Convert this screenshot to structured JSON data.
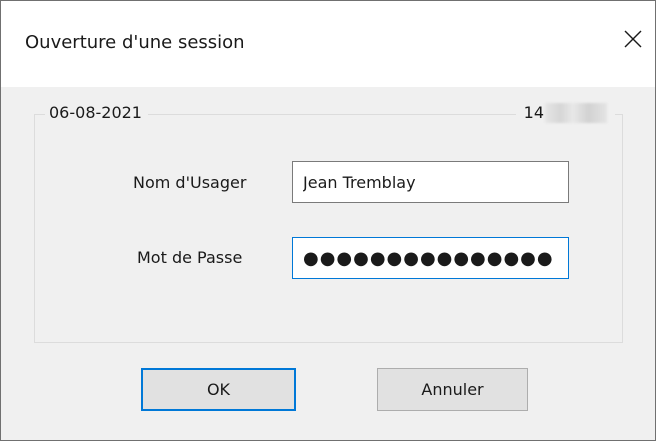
{
  "window": {
    "title": "Ouverture d'une session"
  },
  "group": {
    "date": "06-08-2021",
    "right_prefix": "14"
  },
  "form": {
    "username_label": "Nom d'Usager",
    "username_value": "Jean Tremblay",
    "password_label": "Mot de Passe",
    "password_value": "●●●●●●●●●●●●●●●"
  },
  "buttons": {
    "ok_label": "OK",
    "cancel_label": "Annuler"
  },
  "colors": {
    "focus_accent": "#0078d7",
    "dialog_background": "#f0f0f0",
    "button_face": "#e1e1e1"
  },
  "icons": {
    "close": "close-icon"
  }
}
